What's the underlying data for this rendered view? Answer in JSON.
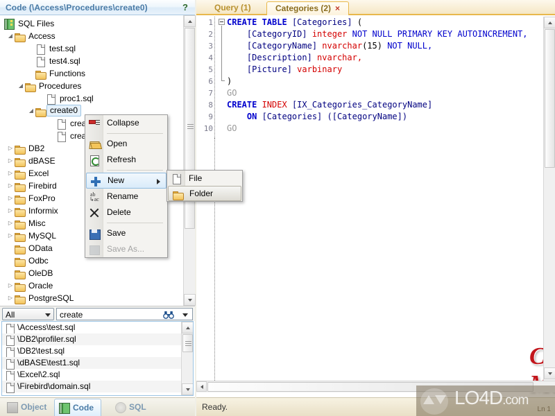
{
  "panel": {
    "title": "Code (\\Access\\Procedures\\create0)",
    "help": "?"
  },
  "tree": {
    "items": [
      {
        "label": "SQL Files",
        "icon": "book-icon",
        "depth": 0,
        "expander": "",
        "selected": false
      },
      {
        "label": "Access",
        "icon": "folder-icon",
        "depth": 1,
        "expander": "▲",
        "selected": false
      },
      {
        "label": "test.sql",
        "icon": "file-icon",
        "depth": 3,
        "expander": "",
        "selected": false
      },
      {
        "label": "test4.sql",
        "icon": "file-icon",
        "depth": 3,
        "expander": "",
        "selected": false
      },
      {
        "label": "Functions",
        "icon": "folder-icon",
        "depth": 3,
        "expander": "",
        "selected": false
      },
      {
        "label": "Procedures",
        "icon": "folder-icon",
        "depth": 2,
        "expander": "▲",
        "selected": false
      },
      {
        "label": "proc1.sql",
        "icon": "file-icon",
        "depth": 4,
        "expander": "",
        "selected": false
      },
      {
        "label": "create0",
        "icon": "folder-icon",
        "depth": 3,
        "expander": "▲",
        "selected": true
      },
      {
        "label": "crea",
        "icon": "file-icon",
        "depth": 5,
        "expander": "",
        "selected": false
      },
      {
        "label": "crea",
        "icon": "file-icon",
        "depth": 5,
        "expander": "",
        "selected": false
      },
      {
        "label": "DB2",
        "icon": "folder-icon",
        "depth": 1,
        "expander": "▶",
        "selected": false
      },
      {
        "label": "dBASE",
        "icon": "folder-icon",
        "depth": 1,
        "expander": "▶",
        "selected": false
      },
      {
        "label": "Excel",
        "icon": "folder-icon",
        "depth": 1,
        "expander": "▶",
        "selected": false
      },
      {
        "label": "Firebird",
        "icon": "folder-icon",
        "depth": 1,
        "expander": "▶",
        "selected": false
      },
      {
        "label": "FoxPro",
        "icon": "folder-icon",
        "depth": 1,
        "expander": "▶",
        "selected": false
      },
      {
        "label": "Informix",
        "icon": "folder-icon",
        "depth": 1,
        "expander": "▶",
        "selected": false
      },
      {
        "label": "Misc",
        "icon": "folder-icon",
        "depth": 1,
        "expander": "▶",
        "selected": false
      },
      {
        "label": "MySQL",
        "icon": "folder-icon",
        "depth": 1,
        "expander": "▶",
        "selected": false
      },
      {
        "label": "OData",
        "icon": "folder-icon",
        "depth": 1,
        "expander": "",
        "selected": false
      },
      {
        "label": "Odbc",
        "icon": "folder-icon",
        "depth": 1,
        "expander": "",
        "selected": false
      },
      {
        "label": "OleDB",
        "icon": "folder-icon",
        "depth": 1,
        "expander": "",
        "selected": false
      },
      {
        "label": "Oracle",
        "icon": "folder-icon",
        "depth": 1,
        "expander": "▶",
        "selected": false
      },
      {
        "label": "PostgreSQL",
        "icon": "folder-icon",
        "depth": 1,
        "expander": "▶",
        "selected": false
      }
    ]
  },
  "context_menu": {
    "items": [
      {
        "label": "Collapse",
        "icon": "collapse-icon",
        "state": "normal",
        "separator_after": true
      },
      {
        "label": "Open",
        "icon": "open-folder-icon",
        "state": "normal",
        "separator_after": false
      },
      {
        "label": "Refresh",
        "icon": "refresh-icon",
        "state": "normal",
        "separator_after": true
      },
      {
        "label": "New",
        "icon": "plus-icon",
        "state": "highlighted",
        "submenu": true,
        "separator_after": false
      },
      {
        "label": "Rename",
        "icon": "rename-abc-icon",
        "state": "normal",
        "separator_after": false
      },
      {
        "label": "Delete",
        "icon": "delete-x-icon",
        "state": "normal",
        "separator_after": true
      },
      {
        "label": "Save",
        "icon": "save-disk-icon",
        "state": "normal",
        "separator_after": false
      },
      {
        "label": "Save As...",
        "icon": "save-as-icon",
        "state": "disabled",
        "separator_after": false
      }
    ]
  },
  "submenu": {
    "items": [
      {
        "label": "File",
        "icon": "file-icon",
        "state": "normal"
      },
      {
        "label": "Folder",
        "icon": "folder-icon",
        "state": "highlighted"
      }
    ]
  },
  "search": {
    "filter_value": "All",
    "query_value": "create",
    "find_icon": "binoculars-icon"
  },
  "results": {
    "items": [
      "\\Access\\test.sql",
      "\\DB2\\profiler.sql",
      "\\DB2\\test.sql",
      "\\dBASE\\test1.sql",
      "\\Excel\\2.sql",
      "\\Firebird\\domain.sql"
    ]
  },
  "bottom_tabs": {
    "items": [
      {
        "label": "Object",
        "icon": "object-tree-icon",
        "active": false
      },
      {
        "label": "Code",
        "icon": "code-book-icon",
        "active": true
      },
      {
        "label": "SQL",
        "icon": "sql-disc-icon",
        "active": false
      }
    ]
  },
  "editor": {
    "tabs": [
      {
        "label": "Query (1)",
        "active": false,
        "closable": false
      },
      {
        "label": "Categories (2)",
        "active": true,
        "closable": true,
        "close_glyph": "×"
      }
    ],
    "line_numbers": [
      "1",
      "2",
      "3",
      "4",
      "5",
      "6",
      "7",
      "8",
      "9",
      "10"
    ],
    "lines": [
      [
        {
          "t": "CREATE ",
          "c": "kw"
        },
        {
          "t": "TABLE ",
          "c": "kw"
        },
        {
          "t": "[Categories]",
          "c": "id"
        },
        {
          "t": " (",
          "c": "pl"
        }
      ],
      [
        {
          "t": "    [CategoryID] ",
          "c": "id"
        },
        {
          "t": "integer ",
          "c": "ty"
        },
        {
          "t": "NOT NULL PRIMARY KEY AUTOINCREMENT,",
          "c": "kw2"
        }
      ],
      [
        {
          "t": "    [CategoryName] ",
          "c": "id"
        },
        {
          "t": "nvarchar",
          "c": "ty"
        },
        {
          "t": "(15) ",
          "c": "pl"
        },
        {
          "t": "NOT NULL,",
          "c": "kw2"
        }
      ],
      [
        {
          "t": "    [Description] ",
          "c": "id"
        },
        {
          "t": "nvarchar,",
          "c": "ty"
        }
      ],
      [
        {
          "t": "    [Picture] ",
          "c": "id"
        },
        {
          "t": "varbinary",
          "c": "ty"
        }
      ],
      [
        {
          "t": ")",
          "c": "pl"
        }
      ],
      [
        {
          "t": "GO",
          "c": "cm"
        }
      ],
      [
        {
          "t": "CREATE ",
          "c": "kw"
        },
        {
          "t": "INDEX ",
          "c": "ty"
        },
        {
          "t": "[IX_Categories_CategoryName]",
          "c": "id"
        }
      ],
      [
        {
          "t": "    ON ",
          "c": "kw"
        },
        {
          "t": "[Categories] ([CategoryName])",
          "c": "id"
        }
      ],
      [
        {
          "t": "GO",
          "c": "cm"
        }
      ]
    ]
  },
  "watermarks": {
    "product": "Code Manager",
    "site_main": "LO4D",
    "site_suffix": ".com"
  },
  "statusbar": {
    "message": "Ready.",
    "line_indicator": "Ln 1"
  },
  "colors": {
    "accent_blue": "#4a7ba6",
    "tab_gold": "#e8b84b",
    "brand_red": "#c2161c",
    "keyword": "#0000cd",
    "type": "#d40000",
    "identifier": "#000080",
    "comment": "#999999"
  }
}
